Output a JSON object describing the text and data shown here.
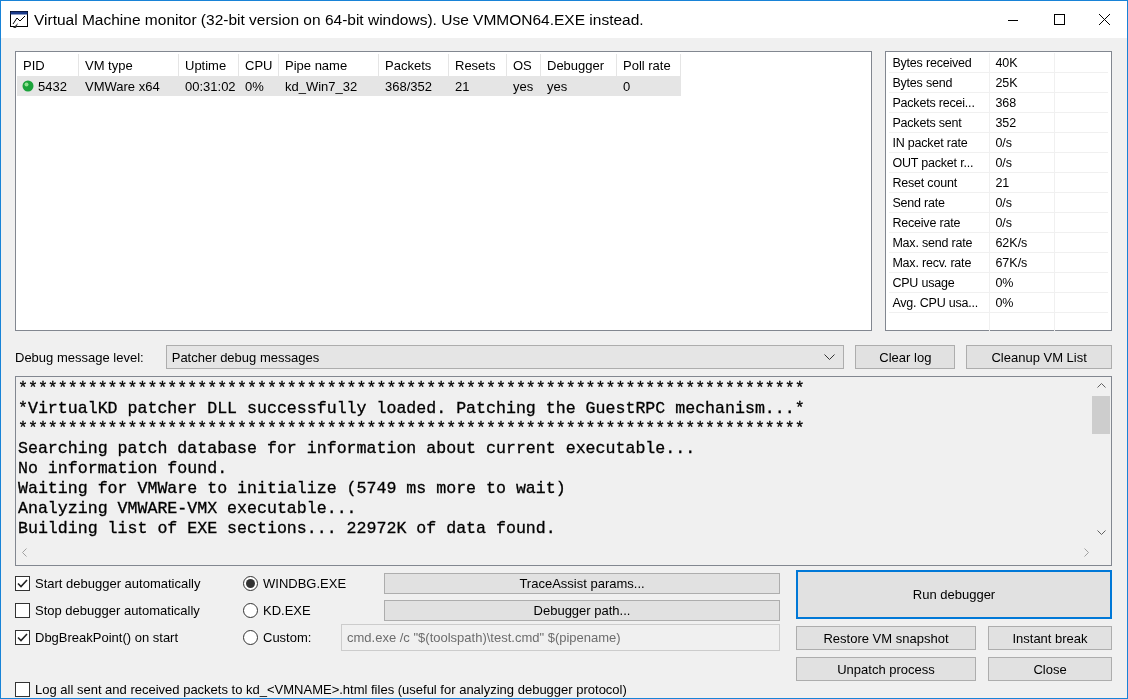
{
  "window": {
    "title": "Virtual Machine monitor (32-bit version on 64-bit windows). Use VMMON64.EXE instead."
  },
  "vm_table": {
    "columns": [
      "PID",
      "VM type",
      "Uptime",
      "CPU",
      "Pipe name",
      "Packets",
      "Resets",
      "OS",
      "Debugger",
      "Poll rate"
    ],
    "rows": [
      {
        "selected": true,
        "cells": [
          "5432",
          "VMWare x64",
          "00:31:02",
          "0%",
          "kd_Win7_32",
          "368/352",
          "21",
          "yes",
          "yes",
          "0"
        ]
      }
    ]
  },
  "stats": [
    {
      "label": "Bytes received",
      "value": "40K"
    },
    {
      "label": "Bytes send",
      "value": "25K"
    },
    {
      "label": "Packets recei...",
      "value": "368"
    },
    {
      "label": "Packets sent",
      "value": "352"
    },
    {
      "label": "IN packet rate",
      "value": "0/s"
    },
    {
      "label": "OUT packet r...",
      "value": "0/s"
    },
    {
      "label": "Reset count",
      "value": "21"
    },
    {
      "label": "Send rate",
      "value": "0/s"
    },
    {
      "label": "Receive rate",
      "value": "0/s"
    },
    {
      "label": "Max. send rate",
      "value": "62K/s"
    },
    {
      "label": "Max. recv. rate",
      "value": "67K/s"
    },
    {
      "label": "CPU usage",
      "value": "0%"
    },
    {
      "label": "Avg. CPU usa...",
      "value": "0%"
    }
  ],
  "debug_level": {
    "label": "Debug message level:",
    "value": "Patcher debug messages"
  },
  "log_buttons": [
    "Clear log",
    "Cleanup VM List"
  ],
  "log": [
    "*******************************************************************************",
    "*VirtualKD patcher DLL successfully loaded. Patching the GuestRPC mechanism...*",
    "*******************************************************************************",
    "Searching patch database for information about current executable...",
    "No information found.",
    "Waiting for VMWare to initialize (5749 ms more to wait)",
    "Analyzing VMWARE-VMX executable...",
    "Building list of EXE sections... 22972K of data found."
  ],
  "options": [
    {
      "label": "Start debugger automatically",
      "checked": true
    },
    {
      "label": "Stop debugger automatically",
      "checked": false
    },
    {
      "label": "DbgBreakPoint() on start",
      "checked": true
    }
  ],
  "debuggers": [
    {
      "label": "WINDBG.EXE",
      "selected": true
    },
    {
      "label": "KD.EXE",
      "selected": false
    },
    {
      "label": "Custom:",
      "selected": false
    }
  ],
  "custom_command": {
    "value": "cmd.exe /c \"$(toolspath)\\test.cmd\" $(pipename)",
    "disabled": true
  },
  "tool_buttons": [
    "TraceAssist params...",
    "Debugger path..."
  ],
  "log_packets": {
    "label": "Log all sent and received packets to kd_<VMNAME>.html files (useful for analyzing debugger protocol)",
    "checked": false
  },
  "actions": {
    "run": "Run debugger",
    "restore": "Restore VM snapshot",
    "instant_break": "Instant break",
    "unpatch": "Unpatch process",
    "close": "Close"
  }
}
